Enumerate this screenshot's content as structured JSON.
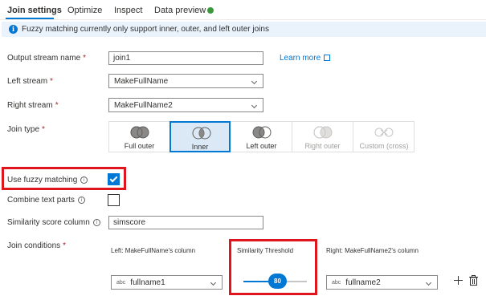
{
  "tabs": [
    {
      "label": "Join settings"
    },
    {
      "label": "Optimize"
    },
    {
      "label": "Inspect"
    },
    {
      "label": "Data preview"
    }
  ],
  "status_dot_color": "#3a9a3a",
  "banner": {
    "icon": "info-icon",
    "icon_glyph": "i",
    "message": "Fuzzy matching currently only support inner, outer, and left outer joins"
  },
  "required_mark": "*",
  "output_stream": {
    "label": "Output stream name",
    "value": "join1",
    "learn_more": "Learn more"
  },
  "left_stream": {
    "label": "Left stream",
    "value": "MakeFullName"
  },
  "right_stream": {
    "label": "Right stream",
    "value": "MakeFullName2"
  },
  "join_type": {
    "label": "Join type",
    "selected": "Inner",
    "options": [
      {
        "label": "Full outer",
        "enabled": true
      },
      {
        "label": "Inner",
        "enabled": true
      },
      {
        "label": "Left outer",
        "enabled": true
      },
      {
        "label": "Right outer",
        "enabled": false
      },
      {
        "label": "Custom (cross)",
        "enabled": false
      }
    ]
  },
  "fuzzy": {
    "label": "Use fuzzy matching",
    "checked": true
  },
  "combine": {
    "label": "Combine text parts",
    "checked": false
  },
  "similarity_column": {
    "label": "Similarity score column",
    "value": "simscore"
  },
  "help_glyph": "i",
  "join_conditions": {
    "label": "Join conditions",
    "left_header": "Left: MakeFullName's column",
    "threshold_header": "Similarity Threshold",
    "right_header": "Right: MakeFullName2's column",
    "type_tag": "abc",
    "left_value": "fullname1",
    "right_value": "fullname2",
    "threshold_value": "80",
    "threshold_fraction": 0.5
  },
  "colors": {
    "accent": "#0078d4",
    "highlight": "#e0161e",
    "required": "#a4262c",
    "banner_bg": "#eaf3fc"
  }
}
